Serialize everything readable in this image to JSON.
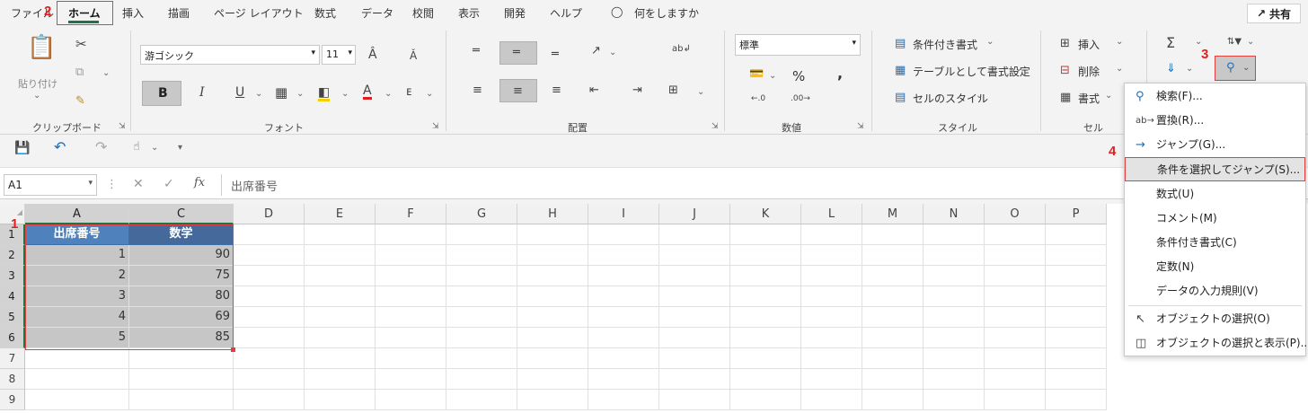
{
  "tabs": {
    "items": [
      "ファイル",
      "ホーム",
      "挿入",
      "描画",
      "ページ レイアウト",
      "数式",
      "データ",
      "校閲",
      "表示",
      "開発",
      "ヘルプ"
    ],
    "tell_me": "何をしますか",
    "share": "共有"
  },
  "steps": {
    "s1": "1",
    "s2": "2",
    "s3": "3",
    "s4": "4"
  },
  "ribbon": {
    "clipboard": {
      "paste": "貼り付け",
      "label": "クリップボード"
    },
    "font": {
      "name": "游ゴシック",
      "size": "11",
      "label": "フォント"
    },
    "alignment": {
      "label": "配置"
    },
    "number": {
      "format": "標準",
      "percent": "%",
      "comma": ",",
      "label": "数値"
    },
    "styles": {
      "conditional": "条件付き書式",
      "table": "テーブルとして書式設定",
      "cell_styles": "セルのスタイル",
      "label": "スタイル"
    },
    "cells": {
      "insert": "挿入",
      "delete": "削除",
      "format": "書式",
      "label": "セル"
    }
  },
  "formula_bar": {
    "name_box": "A1",
    "formula": "出席番号",
    "fx": "fx"
  },
  "grid": {
    "columns": [
      "A",
      "C",
      "D",
      "E",
      "F",
      "G",
      "H",
      "I",
      "J",
      "K",
      "L",
      "M",
      "N",
      "O",
      "P"
    ],
    "rows": [
      "1",
      "2",
      "3",
      "4",
      "5",
      "6",
      "7",
      "8",
      "9"
    ],
    "table": {
      "headers": [
        "出席番号",
        "数学"
      ],
      "rows": [
        [
          "1",
          "90"
        ],
        [
          "2",
          "75"
        ],
        [
          "3",
          "80"
        ],
        [
          "4",
          "69"
        ],
        [
          "5",
          "85"
        ]
      ]
    }
  },
  "find_menu": {
    "items": [
      "検索(F)...",
      "置換(R)...",
      "ジャンプ(G)...",
      "条件を選択してジャンプ(S)...",
      "数式(U)",
      "コメント(M)",
      "条件付き書式(C)",
      "定数(N)",
      "データの入力規則(V)",
      "オブジェクトの選択(O)",
      "オブジェクトの選択と表示(P)..."
    ]
  },
  "colors": {
    "accent": "#217346",
    "table_header": "#4f81bd",
    "highlight": "#e04040"
  }
}
